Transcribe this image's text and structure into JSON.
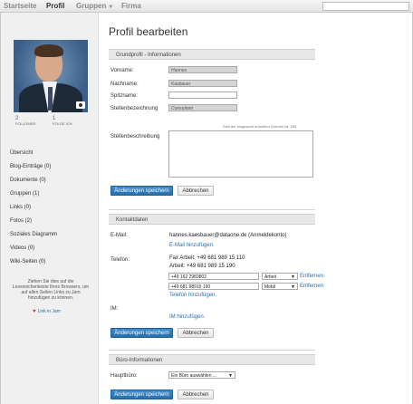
{
  "nav": {
    "items": [
      "Startseite",
      "Profil",
      "Gruppen",
      "Firma"
    ],
    "active": "Profil"
  },
  "sidebar": {
    "stats": [
      {
        "value": "2",
        "label": "FOLLOWER"
      },
      {
        "value": "1",
        "label": "FOLGE ICH"
      }
    ],
    "items": [
      "Übersicht",
      "Blog-Einträge (0)",
      "Dokumente (0)",
      "Gruppen (1)",
      "Links (0)",
      "Fotos (2)",
      "Soziales Diagramm",
      "Videos (0)",
      "Wiki-Seiten (0)"
    ],
    "note": "Ziehen Sie dies auf die Lesezeichenleiste Ihres Browsers, um auf allen Seiten Links zu Jam hinzufügen zu können.",
    "jam_link": "Link in Jam"
  },
  "main": {
    "title": "Profil bearbeiten",
    "basic": {
      "header": "Grundprofil - Informationen",
      "labels": {
        "first": "Vorname:",
        "last": "Nachname:",
        "nick": "Spitzname:",
        "position": "Stellenbezeichnung",
        "description": "Stellenbeschreibung"
      },
      "values": {
        "first": "Hannes",
        "last": "Kasbauer",
        "nick": "",
        "position": "Consultant"
      },
      "hint": "Zahl der insgesamt erlaubten Zeichen ist: 255",
      "save": "Änderungen speichern",
      "cancel": "Abbrechen"
    },
    "contact": {
      "header": "Kontaktdaten",
      "email_label": "E-Mail:",
      "email_value": "hannes.kaesbauer@dataone.de (Anmeldekonto)",
      "email_add": "E-Mail hinzufügen.",
      "phone_label": "Telefon:",
      "fax": "Fax Arbeit: +49 681 989 15 110",
      "work": "Arbeit: +49 681 989 15 190",
      "phones": [
        {
          "number": "+49 162 2983802",
          "type": "Arbeit",
          "remove": "Entfernen"
        },
        {
          "number": "+49 681 98915 190",
          "type": "Mobil",
          "remove": "Entfernen"
        }
      ],
      "phone_add": "Telefon hinzufügen.",
      "im_label": "IM:",
      "im_add": "IM hinzufügen.",
      "save": "Änderungen speichern",
      "cancel": "Abbrechen"
    },
    "office": {
      "header": "Büro-Informationen",
      "label": "Hauptbüro:",
      "select": "Ein Büro auswählen ...",
      "save": "Änderungen speichern",
      "cancel": "Abbrechen"
    }
  }
}
